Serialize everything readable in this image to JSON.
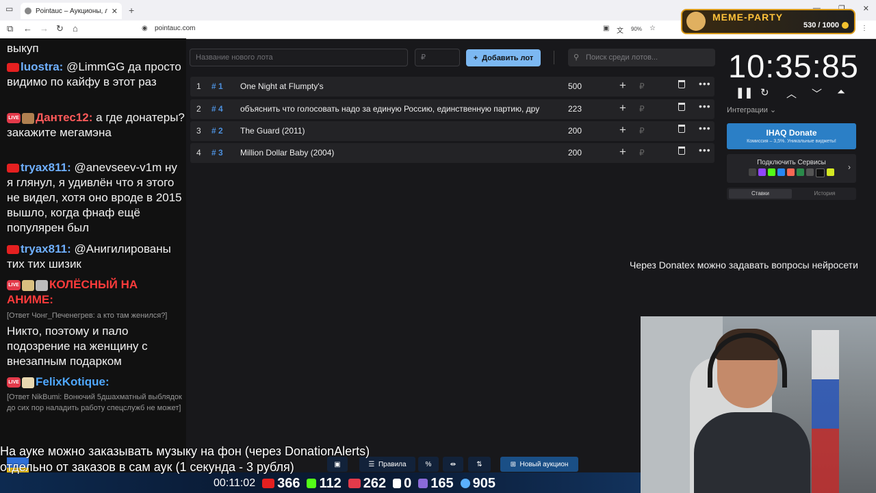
{
  "browser": {
    "tab_title": "Pointauc – Аукционы, лотереи",
    "url": "pointauc.com",
    "zoom": "90%"
  },
  "widget": {
    "title": "MEME-PARTY",
    "count": "530 / 1000"
  },
  "chat": [
    {
      "text": "выкуп"
    },
    {
      "platform": "youtube",
      "nick": "luostra:",
      "nick_color": "#6fb0ff",
      "text": "@LimmGG да просто видимо по кайфу в этот раз"
    },
    {
      "platform": "live",
      "nick": "Дантес12:",
      "nick_color": "#ff5a5a",
      "text": "а где донатеры? закажите мегамэна"
    },
    {
      "platform": "youtube",
      "nick": "tryax811:",
      "nick_color": "#6fb0ff",
      "text": "@anevseev-v1m ну я глянул, я удивлён что я этого не видел, хотя оно вроде в 2015 вышло, когда фнаф ещё популярен был"
    },
    {
      "platform": "youtube",
      "nick": "tryax811:",
      "nick_color": "#6fb0ff",
      "text": "@Анигилированы тих тих шизик"
    },
    {
      "platform": "live",
      "nick": "КОЛЁСНЫЙ НА АНИМЕ:",
      "nick_color": "#ff3b3b"
    },
    {
      "reply": "[Ответ Чонг_Печенегрев: а кто там женился?]",
      "text": "Никто, поэтому и пало подозрение на женщину с внезапным подарком"
    },
    {
      "platform": "live",
      "nick": "FelixKotique:",
      "nick_color": "#4fa8ff"
    },
    {
      "reply": "[Ответ NikBumi: Вонючий 5дшахматный выблядок до сих пор наладить работу спецслужб не может]"
    }
  ],
  "auction": {
    "lot_name_placeholder": "Название нового лота",
    "amount_placeholder": "₽",
    "add_lot_label": "Добавить лот",
    "search_placeholder": "Поиск среди лотов...",
    "lots": [
      {
        "num": "1",
        "id": "# 1",
        "name": "One Night at Flumpty's",
        "amount": "500"
      },
      {
        "num": "2",
        "id": "# 4",
        "name": "объяснить что голосовать надо за единую Россию, единственную партию, дру",
        "amount": "223"
      },
      {
        "num": "3",
        "id": "# 2",
        "name": "The Guard (2011)",
        "amount": "200"
      },
      {
        "num": "4",
        "id": "# 3",
        "name": "Million Dollar Baby (2004)",
        "amount": "200"
      }
    ]
  },
  "side": {
    "timer": "10:35:85",
    "integrations_label": "Интеграции",
    "ihaq_title": "IHAQ Donate",
    "ihaq_sub": "Комиссия – 3,5%. Уникальные виджеты!",
    "services_label": "Подключить Сервисы",
    "tab_bets": "Ставки",
    "tab_history": "История"
  },
  "note": "Через Donatex можно задавать вопросы нейросети",
  "caption": {
    "line1": "На ауке можно заказывать музыку на фон (через DonationAlerts)",
    "line2": "отдельно от заказов в сам аук (1 секунда - 3 рубля)"
  },
  "bottom_bar": {
    "rules_label": "Правила",
    "new_auction_label": "Новый аукцион"
  },
  "stats": {
    "time": "00:11:02",
    "youtube": "366",
    "kick": "112",
    "live": "262",
    "r": "0",
    "other": "165",
    "viewers": "905"
  },
  "colors": {
    "accent": "#7cb8f2",
    "ihaq": "#2b7fc6",
    "id_blue": "#4c8fdc"
  }
}
